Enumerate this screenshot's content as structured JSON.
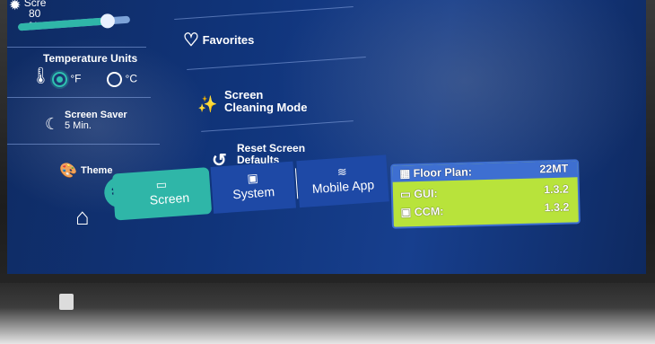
{
  "brightness": {
    "label_partial": "Scre",
    "value": "80 %",
    "level": 0.8
  },
  "temperature": {
    "title": "Temperature Units",
    "option_f": "°F",
    "option_c": "°C",
    "selected": "F"
  },
  "screen_saver": {
    "title": "Screen Saver",
    "value": "5 Min."
  },
  "theme": {
    "label": "Theme"
  },
  "menu": {
    "favorites": "Favorites",
    "cleaning": "Screen Cleaning Mode",
    "cleaning_line1": "Screen",
    "cleaning_line2": "Cleaning Mode",
    "reset_line1": "Reset Screen",
    "reset_line2": "Defaults"
  },
  "tabs": [
    {
      "label": "Screen",
      "icon": "screen-icon",
      "active": true
    },
    {
      "label": "System",
      "icon": "chip-icon",
      "active": false
    },
    {
      "label": "Mobile App",
      "icon": "layers-icon",
      "active": false
    }
  ],
  "nav": {
    "home_icon": "home-icon",
    "settings_icon": "gear-icon"
  },
  "info": {
    "floor_plan_label": "Floor Plan:",
    "floor_plan_value": "22MT",
    "gui_label": "GUI:",
    "gui_value": "1.3.2",
    "ccm_label": "CCM:",
    "ccm_value": "1.3.2"
  },
  "colors": {
    "accent_teal": "#2fb6a8",
    "panel_blue": "#10347a",
    "info_green": "#b8e33b",
    "info_border": "#3e6fd1"
  }
}
